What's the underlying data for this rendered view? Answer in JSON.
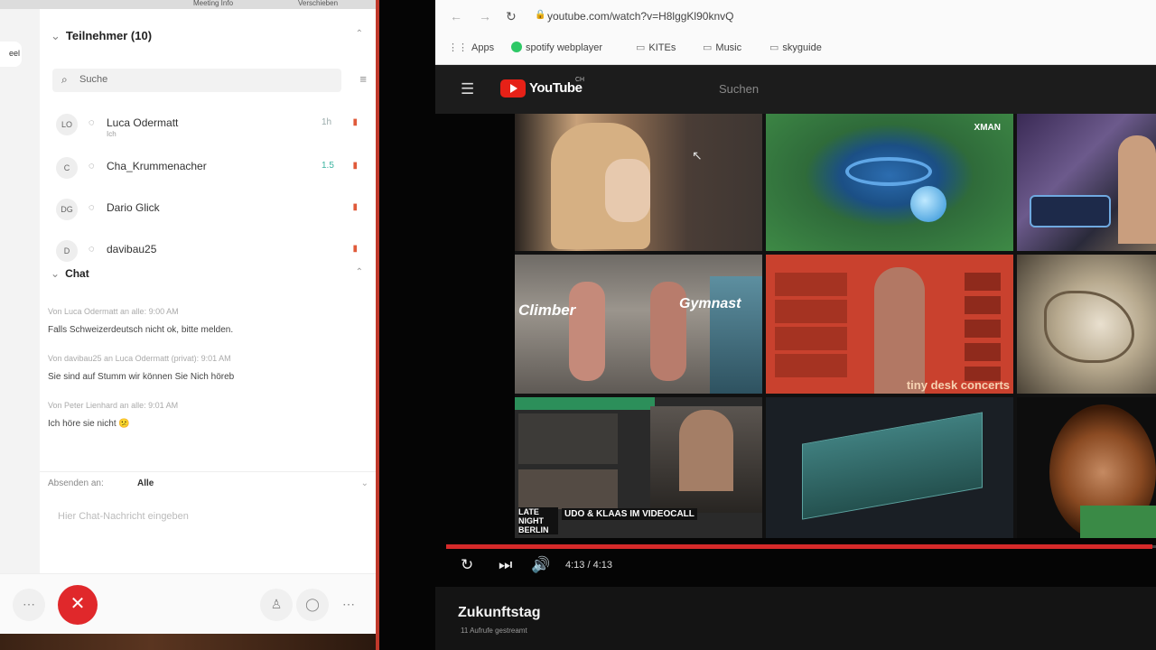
{
  "meeting": {
    "topstrip": {
      "left": "Meeting Info",
      "right": "Verschieben"
    },
    "rail_label": "eel",
    "participants": {
      "header": "Teilnehmer (10)",
      "search_placeholder": "Suche",
      "items": [
        {
          "initials": "LO",
          "name": "Luca Odermatt",
          "sub": "Ich",
          "extra": "1h"
        },
        {
          "initials": "C",
          "name": "Cha_Krummenacher",
          "sub": "",
          "extra": "1.5"
        },
        {
          "initials": "DG",
          "name": "Dario Glick",
          "sub": "",
          "extra": ""
        },
        {
          "initials": "D",
          "name": "davibau25",
          "sub": "",
          "extra": ""
        }
      ]
    },
    "chat": {
      "header": "Chat",
      "messages": [
        {
          "meta": "Von Luca Odermatt an alle:  9:00 AM",
          "text": "Falls Schweizerdeutsch nicht ok, bitte melden."
        },
        {
          "meta": "Von davibau25 an Luca Odermatt (privat):  9:01 AM",
          "text": "Sie sind auf Stumm wir können Sie Nich höreb"
        },
        {
          "meta": "Von Peter Lienhard an alle:  9:01 AM",
          "text": "Ich höre sie nicht 😕"
        }
      ],
      "send_to_label": "Absenden an:",
      "send_to_value": "Alle",
      "input_placeholder": "Hier Chat-Nachricht eingeben"
    },
    "accent_red": "#e0282b"
  },
  "browser": {
    "url": "youtube.com/watch?v=H8lggKl90knvQ",
    "bookmarks": [
      "Apps",
      "spotify webplayer",
      "KITEs",
      "Music",
      "skyguide"
    ]
  },
  "youtube": {
    "logo_text": "YouTube",
    "logo_suffix": "CH",
    "search_placeholder": "Suchen",
    "tiles": [
      {
        "label": ""
      },
      {
        "label": "XMAN"
      },
      {
        "label": ""
      },
      {
        "label": "Climber"
      },
      {
        "label": "Gymnast"
      },
      {
        "label": "tiny desk concerts"
      },
      {
        "label": ""
      },
      {
        "label": "LATE NIGHT BERLIN"
      },
      {
        "label": "UDO & KLAAS IM VIDEOCALL"
      },
      {
        "label": ""
      },
      {
        "label": ""
      }
    ],
    "progress": 0.995,
    "time": "4:13 / 4:13",
    "video_title": "Zukunftstag",
    "video_sub": "11 Aufrufe  gestreamt"
  }
}
